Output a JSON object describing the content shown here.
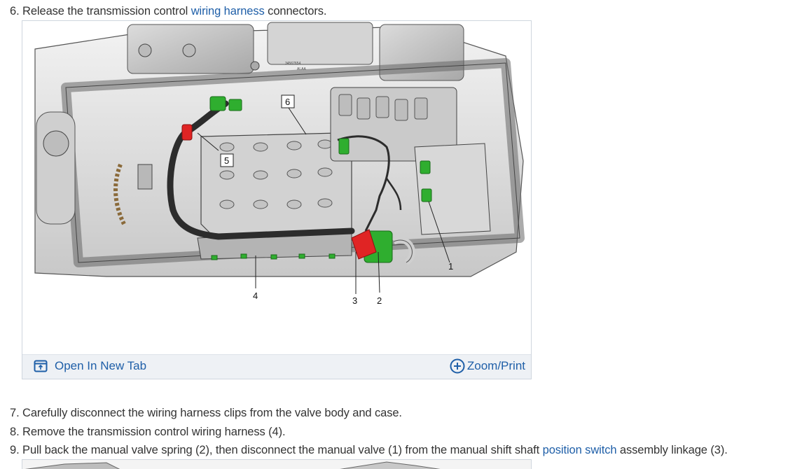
{
  "steps": [
    {
      "prefix": "6. Release the transmission control ",
      "link": "wiring harness",
      "suffix": " connectors."
    },
    {
      "text": "7. Carefully disconnect the wiring harness clips from the valve body and case."
    },
    {
      "text": "8. Remove the transmission control wiring harness (4)."
    },
    {
      "prefix": "9. Pull back the manual valve spring (2), then disconnect the manual valve (1) from the manual shift shaft ",
      "link": "position switch",
      "suffix": " assembly linkage (3)."
    }
  ],
  "figure": {
    "part_number": "34567654",
    "part_number_sub": "ALAA",
    "callouts": [
      "1",
      "2",
      "3",
      "4",
      "5",
      "6"
    ],
    "open_tab_label": "Open In New Tab",
    "zoom_label": "Zoom/Print"
  },
  "colors": {
    "link": "#1f5fa8",
    "connector_green": "#2fae2f",
    "connector_red": "#e02424",
    "metal_light": "#e4e4e4",
    "metal_dark": "#9a9a9a"
  },
  "icons": {
    "open_tab": "open-new-tab-icon",
    "zoom": "zoom-plus-icon"
  }
}
